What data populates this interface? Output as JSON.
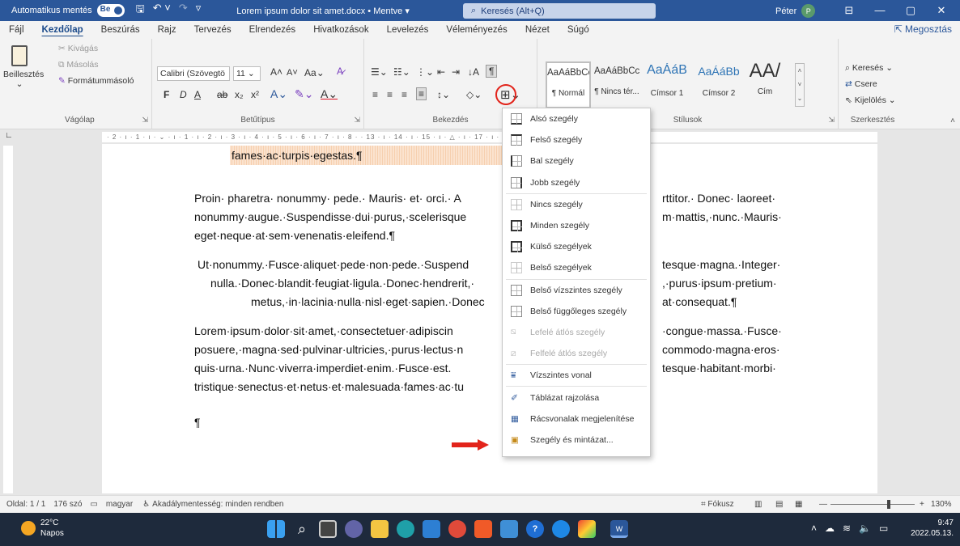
{
  "titlebar": {
    "autosave_label": "Automatikus mentés",
    "toggle_label": "Be",
    "doc_title": "Lorem ipsum dolor sit amet.docx • Mentve ▾",
    "search_placeholder": "Keresés (Alt+Q)",
    "user_name": "Péter",
    "user_initial": "P",
    "bg_color": "#2b579a"
  },
  "menubar": {
    "items": [
      "Fájl",
      "Kezdőlap",
      "Beszúrás",
      "Rajz",
      "Tervezés",
      "Elrendezés",
      "Hivatkozások",
      "Levelezés",
      "Véleményezés",
      "Nézet",
      "Súgó"
    ],
    "active": "Kezdőlap",
    "share_label": "Megosztás"
  },
  "ribbon": {
    "clipboard": {
      "paste_label": "Beillesztés",
      "cut_label": "Kivágás",
      "copy_label": "Másolás",
      "format_painter_label": "Formátummásoló",
      "group_label": "Vágólap"
    },
    "font": {
      "family_value": "Calibri (Szövegtö",
      "size_value": "11",
      "case_label": "Aa",
      "group_label": "Betűtípus"
    },
    "paragraph": {
      "group_label": "Bekezdés"
    },
    "styles": {
      "tiles": [
        {
          "sample": "AaÁáBbCc",
          "name": "¶ Normál"
        },
        {
          "sample": "AaÁáBbCc",
          "name": "¶ Nincs tér..."
        },
        {
          "sample": "AaÁáB",
          "name": "Címsor 1"
        },
        {
          "sample": "AaÁáBb",
          "name": "Címsor 2"
        },
        {
          "sample": "AA/",
          "name": "Cím"
        }
      ],
      "group_label": "Stílusok"
    },
    "editing": {
      "find_label": "Keresés",
      "replace_label": "Csere",
      "select_label": "Kijelölés",
      "group_label": "Szerkesztés"
    }
  },
  "ruler": {
    "text": "· 2 · ı · 1 · ı · ⌄ · ı · 1 · ı · 2 · ı · 3 · ı · 4 · ı · 5 · ı · 6 · ı · 7 · ı · 8 ·                                                            · 13 · ı · 14 · ı · 15 · ı · △ · ı · 17 · ı · 18 ·"
  },
  "document": {
    "p0": "fames·ac·turpis·egestas.¶",
    "p1_lines": [
      "Proin· pharetra· nonummy· pede.· Mauris· et· orci.· A",
      "nonummy·augue.·Suspendisse·dui·purus,·scelerisque",
      "eget·neque·at·sem·venenatis·eleifend.¶"
    ],
    "p1_right": [
      "rttitor.· Donec· laoreet·",
      "m·mattis,·nunc.·Mauris·"
    ],
    "p2_lines": [
      "Ut·nonummy.·Fusce·aliquet·pede·non·pede.·Suspend",
      "nulla.·Donec·blandit·feugiat·ligula.·Donec·hendrerit,·",
      "metus,·in·lacinia·nulla·nisl·eget·sapien.·Donec"
    ],
    "p2_right": [
      "tesque·magna.·Integer·",
      ",·purus·ipsum·pretium·",
      "at·consequat.¶"
    ],
    "p3_lines": [
      "Lorem·ipsum·dolor·sit·amet,·consectetuer·adipiscin",
      "posuere,·magna·sed·pulvinar·ultricies,·purus·lectus·n",
      "quis·urna.·Nunc·viverra·imperdiet·enim.·Fusce·est.",
      "tristique·senectus·et·netus·et·malesuada·fames·ac·tu"
    ],
    "p3_right": [
      "·congue·massa.·Fusce·",
      "commodo·magna·eros·",
      "tesque·habitant·morbi·"
    ],
    "p4": "¶"
  },
  "border_menu": {
    "items": [
      {
        "label": "Alsó szegély",
        "enabled": true
      },
      {
        "label": "Felső szegély",
        "enabled": true
      },
      {
        "label": "Bal szegély",
        "enabled": true
      },
      {
        "label": "Jobb szegély",
        "enabled": true
      },
      {
        "label": "Nincs szegély",
        "enabled": true
      },
      {
        "label": "Minden szegély",
        "enabled": true
      },
      {
        "label": "Külső szegélyek",
        "enabled": true
      },
      {
        "label": "Belső szegélyek",
        "enabled": true
      },
      {
        "label": "Belső vízszintes szegély",
        "enabled": true
      },
      {
        "label": "Belső függőleges szegély",
        "enabled": true
      },
      {
        "label": "Lefelé átlós szegély",
        "enabled": false
      },
      {
        "label": "Felfelé átlós szegély",
        "enabled": false
      },
      {
        "label": "Vízszintes vonal",
        "enabled": true
      },
      {
        "label": "Táblázat rajzolása",
        "enabled": true
      },
      {
        "label": "Rácsvonalak megjelenítése",
        "enabled": true
      },
      {
        "label": "Szegély és mintázat...",
        "enabled": true
      }
    ],
    "highlight_color": "#e2241b"
  },
  "statusbar": {
    "page": "Oldal: 1 / 1",
    "words": "176 szó",
    "language": "magyar",
    "accessibility": "Akadálymentesség: minden rendben",
    "focus": "Fókusz",
    "zoom": "130%"
  },
  "taskbar": {
    "temp": "22°C",
    "weather": "Napos",
    "time": "9:47",
    "date": "2022.05.13."
  }
}
